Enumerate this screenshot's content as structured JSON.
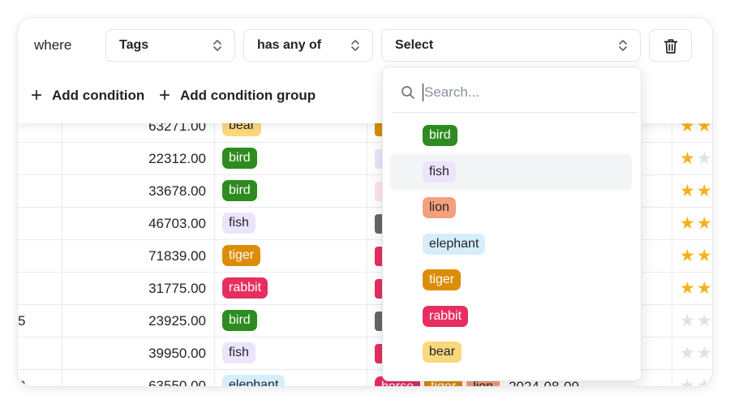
{
  "filter": {
    "where_label": "where",
    "field_select": "Tags",
    "operator_select": "has any of",
    "value_select": "Select",
    "add_condition": "Add condition",
    "add_condition_group": "Add condition group"
  },
  "dropdown": {
    "search_placeholder": "Search...",
    "options": [
      {
        "label": "bird",
        "bg": "#2e8b1f",
        "fg": "#ffffff"
      },
      {
        "label": "fish",
        "bg": "#ece4fb",
        "fg": "#1f2328"
      },
      {
        "label": "lion",
        "bg": "#f4a07d",
        "fg": "#1f2328"
      },
      {
        "label": "elephant",
        "bg": "#d6eefb",
        "fg": "#1f2328"
      },
      {
        "label": "tiger",
        "bg": "#dc8d06",
        "fg": "#ffffff"
      },
      {
        "label": "rabbit",
        "bg": "#e62e60",
        "fg": "#ffffff"
      },
      {
        "label": "bear",
        "bg": "#fbd77d",
        "fg": "#1f2328"
      }
    ],
    "highlighted_index": 1
  },
  "table": {
    "rows": [
      {
        "id": "",
        "amount": "63271.00",
        "tag": "bear",
        "partial": "#dc8d06",
        "stars": 2
      },
      {
        "id": "",
        "amount": "22312.00",
        "tag": "bird",
        "partial": "#ece4fb",
        "stars": 1
      },
      {
        "id": "",
        "amount": "33678.00",
        "tag": "bird",
        "partial": "#fde3ea",
        "stars": 2
      },
      {
        "id": "",
        "amount": "46703.00",
        "tag": "fish",
        "partial": "#666666",
        "stars": 2
      },
      {
        "id": "",
        "amount": "71839.00",
        "tag": "tiger",
        "partial": "#e62e60",
        "stars": 2
      },
      {
        "id": "",
        "amount": "31775.00",
        "tag": "rabbit",
        "partial": "#e62e60",
        "stars": 2
      },
      {
        "id": "5",
        "amount": "23925.00",
        "tag": "bird",
        "partial": "#666666",
        "stars": 0
      },
      {
        "id": "",
        "amount": "39950.00",
        "tag": "fish",
        "partial": "#e62e60",
        "stars": 0
      },
      {
        "id": "2",
        "amount": "63550.00",
        "tag": "elephant",
        "stars": 0,
        "extra_tags": [
          "horse",
          "tiger",
          "lion"
        ],
        "date": "2024-08-09"
      }
    ],
    "tag_colors": {
      "bear": {
        "bg": "#fbd77d",
        "fg": "#1f2328"
      },
      "bird": {
        "bg": "#2e8b1f",
        "fg": "#ffffff"
      },
      "fish": {
        "bg": "#ece4fb",
        "fg": "#1f2328"
      },
      "tiger": {
        "bg": "#dc8d06",
        "fg": "#ffffff"
      },
      "rabbit": {
        "bg": "#e62e60",
        "fg": "#ffffff"
      },
      "elephant": {
        "bg": "#d6eefb",
        "fg": "#1f2328"
      },
      "horse": {
        "bg": "#e62e60",
        "fg": "#ffffff"
      },
      "lion": {
        "bg": "#f4a07d",
        "fg": "#1f2328"
      }
    }
  },
  "icons": {
    "chevron": "chevron-up-down-icon",
    "delete": "trash-icon",
    "search": "search-icon",
    "add": "plus-icon",
    "rating": "star-icon"
  }
}
